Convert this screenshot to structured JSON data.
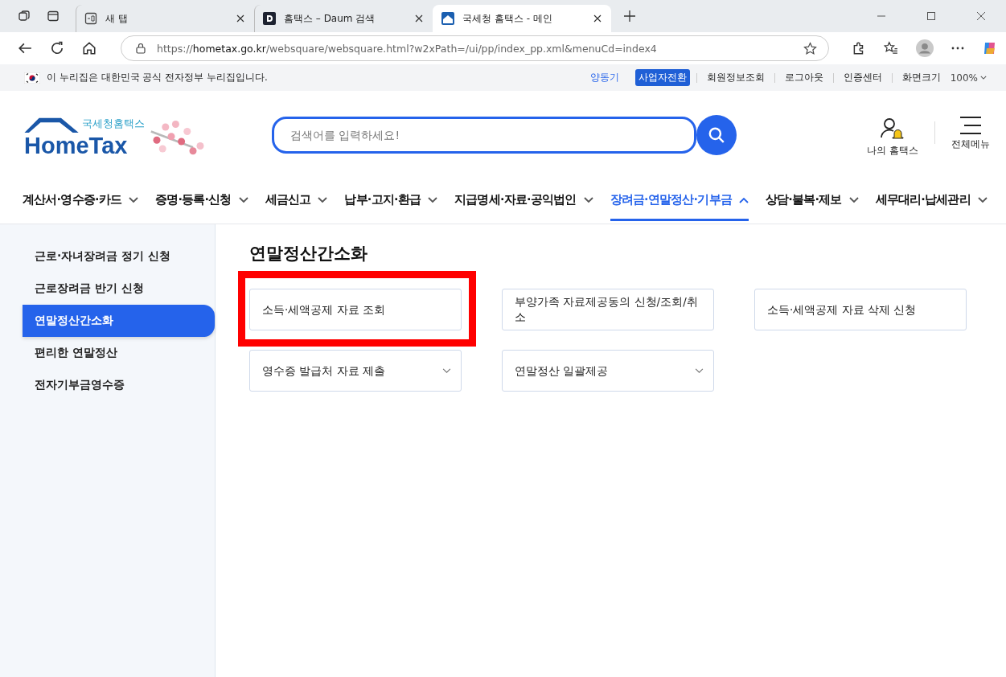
{
  "browser": {
    "tabs": [
      {
        "title": "새 탭",
        "kind": "newtab",
        "selected": false
      },
      {
        "title": "홈택스 – Daum 검색",
        "kind": "daum",
        "selected": false
      },
      {
        "title": "국세청 홈택스 - 메인",
        "kind": "hometax",
        "selected": true
      }
    ],
    "url": "https://**hometax.go.kr**/websquare/websquare.html?w2xPath=/ui/pp/index_pp.xml&menuCd=index4"
  },
  "gov_banner": {
    "text": "이 누리집은 대한민국 공식 전자정부 누리집입니다.",
    "links": [
      {
        "label": "양동기",
        "kind": "user"
      },
      {
        "label": "사업자전환",
        "kind": "badge"
      },
      {
        "label": "회원정보조회",
        "kind": "link"
      },
      {
        "label": "로그아웃",
        "kind": "link"
      },
      {
        "label": "인증센터",
        "kind": "link"
      },
      {
        "label": "화면크기",
        "kind": "zoom",
        "value": "100%"
      }
    ]
  },
  "header": {
    "logo_caption": "국세청홈택스",
    "logo_text": "HomeTax",
    "search": {
      "placeholder": "검색어를 입력하세요!"
    },
    "my_hometax": "나의 홈택스",
    "all_menu": "전체메뉴"
  },
  "nav": [
    {
      "label": "계산서·영수증·카드",
      "selected": false
    },
    {
      "label": "증명·등록·신청",
      "selected": false
    },
    {
      "label": "세금신고",
      "selected": false
    },
    {
      "label": "납부·고지·환급",
      "selected": false
    },
    {
      "label": "지급명세·자료·공익법인",
      "selected": false
    },
    {
      "label": "장려금·연말정산·기부금",
      "selected": true
    },
    {
      "label": "상담·불복·제보",
      "selected": false
    },
    {
      "label": "세무대리·납세관리",
      "selected": false
    }
  ],
  "sidebar": [
    {
      "label": "근로·자녀장려금 정기 신청",
      "selected": false
    },
    {
      "label": "근로장려금 반기 신청",
      "selected": false
    },
    {
      "label": "연말정산간소화",
      "selected": true
    },
    {
      "label": "편리한 연말정산",
      "selected": false
    },
    {
      "label": "전자기부금영수증",
      "selected": false
    }
  ],
  "content": {
    "title": "연말정산간소화",
    "cards": [
      {
        "label": "소득·세액공제 자료 조회",
        "kind": "link",
        "highlighted": true
      },
      {
        "label": "부양가족 자료제공동의 신청/조회/취소",
        "kind": "link",
        "highlighted": false
      },
      {
        "label": "소득·세액공제 자료 삭제 신청",
        "kind": "link",
        "highlighted": false
      },
      {
        "label": "영수증 발급처 자료 제출",
        "kind": "dropdown",
        "highlighted": false
      },
      {
        "label": "연말정산 일괄제공",
        "kind": "dropdown",
        "highlighted": false
      }
    ]
  }
}
